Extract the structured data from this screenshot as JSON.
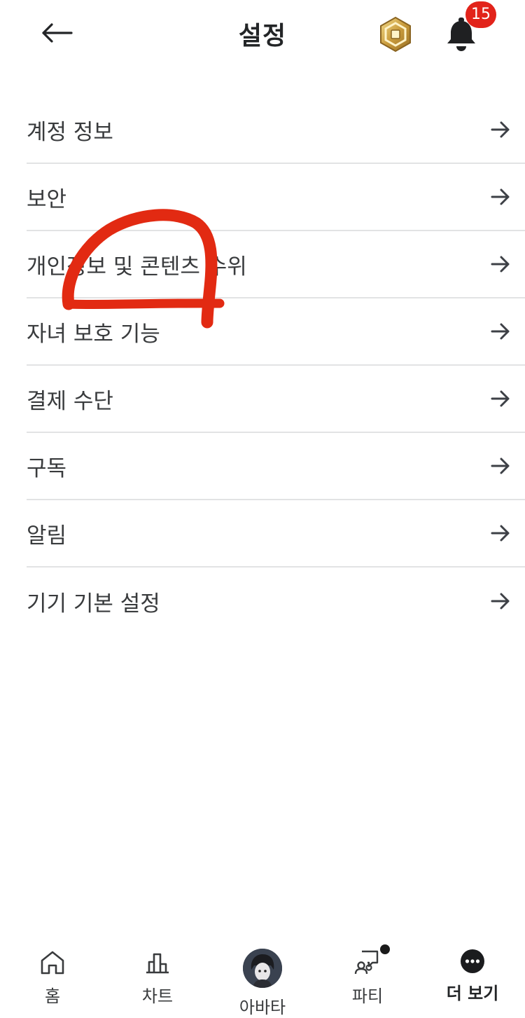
{
  "header": {
    "back_icon": "arrow-left-icon",
    "title": "설정",
    "robux_icon": "robux-icon",
    "bell_icon": "bell-icon",
    "notification_count": "15",
    "badge_color": "#e2231a"
  },
  "settings": {
    "items": [
      {
        "label": "계정 정보",
        "icon": "arrow-right-icon"
      },
      {
        "label": "보안",
        "icon": "arrow-right-icon"
      },
      {
        "label": "개인정보 및 콘텐츠 수위",
        "icon": "arrow-right-icon"
      },
      {
        "label": "자녀 보호 기능",
        "icon": "arrow-right-icon"
      },
      {
        "label": "결제 수단",
        "icon": "arrow-right-icon"
      },
      {
        "label": "구독",
        "icon": "arrow-right-icon"
      },
      {
        "label": "알림",
        "icon": "arrow-right-icon"
      },
      {
        "label": "기기 기본 설정",
        "icon": "arrow-right-icon"
      }
    ]
  },
  "annotation": {
    "color": "#e22a12",
    "description_icon": "red-scribble-annotation"
  },
  "bottom_nav": {
    "items": [
      {
        "label": "홈",
        "icon": "home-icon"
      },
      {
        "label": "차트",
        "icon": "chart-icon"
      },
      {
        "label": "아바타",
        "icon": "avatar-icon"
      },
      {
        "label": "파티",
        "icon": "party-icon"
      },
      {
        "label": "더 보기",
        "icon": "more-icon",
        "active": true
      }
    ]
  }
}
